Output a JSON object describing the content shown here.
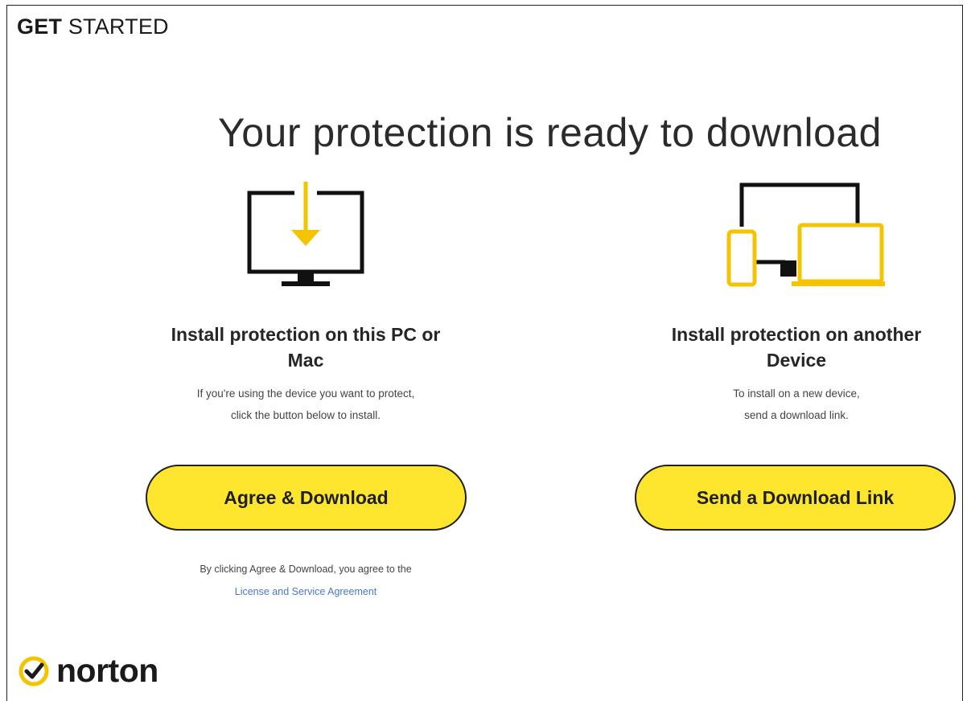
{
  "header": {
    "get_started_bold": "GET",
    "get_started_light": "STARTED"
  },
  "headline": "Your protection is ready to download",
  "left_card": {
    "title_line1": "Install protection on this PC or",
    "title_line2": "Mac",
    "desc_line1": "If you're using the device you want to protect,",
    "desc_line2": "click the button below to install.",
    "button_label": "Agree & Download",
    "legal_text": "By clicking Agree & Download, you agree to the",
    "legal_link": "License and Service Agreement",
    "icon": "monitor-download-icon"
  },
  "right_card": {
    "title_line1": "Install protection on another",
    "title_line2": "Device",
    "desc_line1": "To install on a new device,",
    "desc_line2": "send a download link.",
    "button_label": "Send a Download Link",
    "icon": "multi-device-icon"
  },
  "brand": {
    "name": "norton",
    "icon": "norton-check-icon"
  },
  "colors": {
    "accent_yellow": "#ffe62e",
    "icon_yellow": "#f5c400",
    "link_blue": "#4b78c8",
    "ink": "#1a1a1a"
  }
}
